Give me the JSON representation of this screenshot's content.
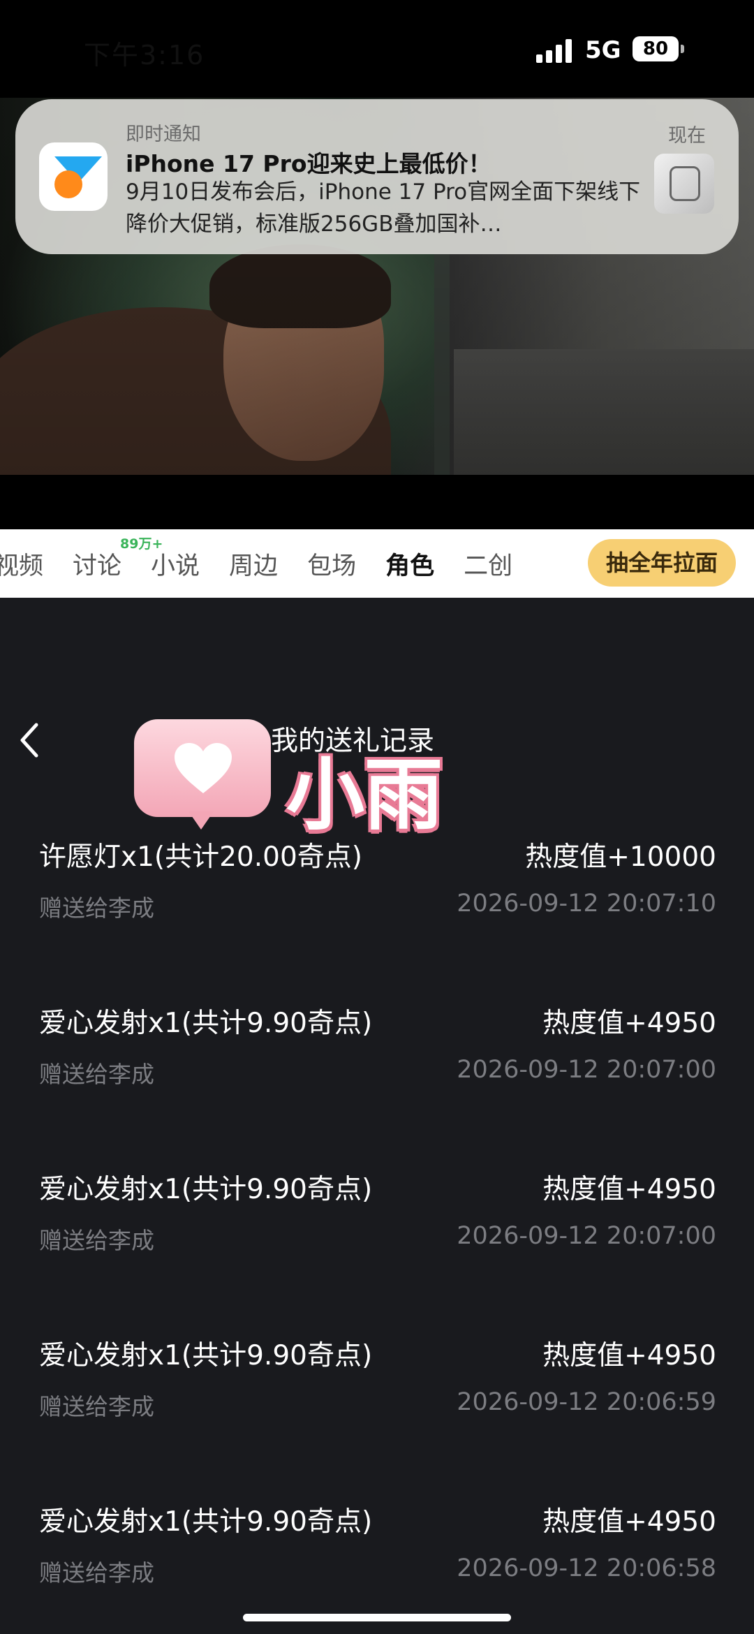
{
  "status_bar": {
    "time": "下午3:16",
    "network": "5G",
    "battery": "80"
  },
  "notification": {
    "app_name": "即时通知",
    "time": "现在",
    "title": "iPhone 17 Pro迎来史上最低价！",
    "body": "9月10日发布会后，iPhone 17 Pro官网全面下架线下降价大促销，标准版256GB叠加国补…"
  },
  "tabs": {
    "items": [
      {
        "label": "视频"
      },
      {
        "label": "讨论",
        "badge": "89万+"
      },
      {
        "label": "小说"
      },
      {
        "label": "周边"
      },
      {
        "label": "包场"
      },
      {
        "label": "角色",
        "active": true
      },
      {
        "label": "二创"
      }
    ],
    "cta": "抽全年拉面"
  },
  "page": {
    "title": "我的送礼记录",
    "overlay_name": "小雨"
  },
  "records": [
    {
      "item": "许愿灯x1(共计20.00奇点)",
      "heat": "热度值+10000",
      "recipient": "赠送给李成",
      "time": "2026-09-12 20:07:10"
    },
    {
      "item": "爱心发射x1(共计9.90奇点)",
      "heat": "热度值+4950",
      "recipient": "赠送给李成",
      "time": "2026-09-12 20:07:00"
    },
    {
      "item": "爱心发射x1(共计9.90奇点)",
      "heat": "热度值+4950",
      "recipient": "赠送给李成",
      "time": "2026-09-12 20:07:00"
    },
    {
      "item": "爱心发射x1(共计9.90奇点)",
      "heat": "热度值+4950",
      "recipient": "赠送给李成",
      "time": "2026-09-12 20:06:59"
    },
    {
      "item": "爱心发射x1(共计9.90奇点)",
      "heat": "热度值+4950",
      "recipient": "赠送给李成",
      "time": "2026-09-12 20:06:58"
    }
  ],
  "colors": {
    "accent": "#f7cf73",
    "background": "#191a1e",
    "badge": "#3ab45a",
    "muted_text": "#7c7d82"
  }
}
